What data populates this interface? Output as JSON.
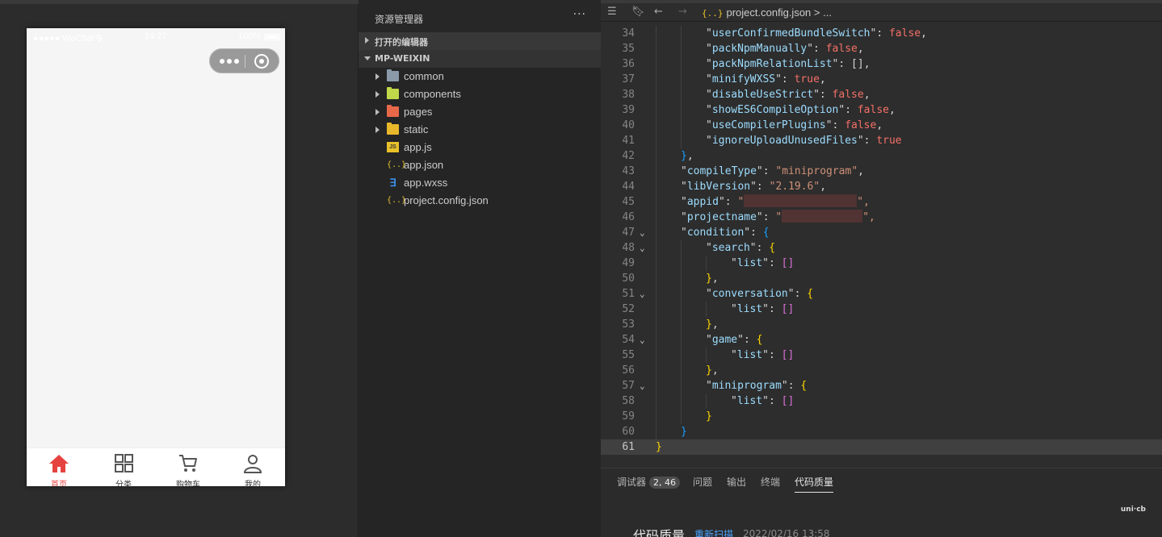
{
  "simulator": {
    "statusbar": {
      "carrier": "●●●●● WeChat令",
      "time": "14:27",
      "battery": "100%"
    },
    "tabbar": [
      {
        "label": "首页",
        "icon": "home-icon",
        "active": true
      },
      {
        "label": "分类",
        "icon": "grid-icon",
        "active": false
      },
      {
        "label": "购物车",
        "icon": "cart-icon",
        "active": false
      },
      {
        "label": "我的",
        "icon": "user-icon",
        "active": false
      }
    ],
    "accent_color": "#e64340"
  },
  "explorer": {
    "title": "资源管理器",
    "more": "···",
    "open_editors": "打开的编辑器",
    "project": "MP-WEIXIN",
    "items": [
      {
        "name": "common",
        "type": "folder",
        "color": "#8a9aa8"
      },
      {
        "name": "components",
        "type": "folder",
        "color": "#c0d74a"
      },
      {
        "name": "pages",
        "type": "folder",
        "color": "#e8684a"
      },
      {
        "name": "static",
        "type": "folder",
        "color": "#e8b82a"
      },
      {
        "name": "app.js",
        "type": "file-js",
        "glyph": "JS"
      },
      {
        "name": "app.json",
        "type": "file-json",
        "glyph": "{..}"
      },
      {
        "name": "app.wxss",
        "type": "file-css",
        "glyph": "∃"
      },
      {
        "name": "project.config.json",
        "type": "file-json",
        "glyph": "{..}"
      }
    ]
  },
  "editor": {
    "breadcrumb": {
      "icon": "{..}",
      "file": "project.config.json",
      "suffix": "> ..."
    },
    "lines": [
      {
        "n": "34",
        "indent": 2,
        "key": "userConfirmedBundleSwitch",
        "val": "false",
        "vtype": "b",
        "end": ","
      },
      {
        "n": "35",
        "indent": 2,
        "key": "packNpmManually",
        "val": "false",
        "vtype": "b",
        "end": ","
      },
      {
        "n": "36",
        "indent": 2,
        "key": "packNpmRelationList",
        "val": "[]",
        "vtype": "p",
        "end": ","
      },
      {
        "n": "37",
        "indent": 2,
        "key": "minifyWXSS",
        "val": "true",
        "vtype": "b",
        "end": ","
      },
      {
        "n": "38",
        "indent": 2,
        "key": "disableUseStrict",
        "val": "false",
        "vtype": "b",
        "end": ","
      },
      {
        "n": "39",
        "indent": 2,
        "key": "showES6CompileOption",
        "val": "false",
        "vtype": "b",
        "end": ","
      },
      {
        "n": "40",
        "indent": 2,
        "key": "useCompilerPlugins",
        "val": "false",
        "vtype": "b",
        "end": ","
      },
      {
        "n": "41",
        "indent": 2,
        "key": "ignoreUploadUnusedFiles",
        "val": "true",
        "vtype": "b",
        "end": ""
      },
      {
        "n": "42",
        "indent": 1,
        "close": "}",
        "cls": "br2",
        "end": ","
      },
      {
        "n": "43",
        "indent": 1,
        "key": "compileType",
        "val": "\"miniprogram\"",
        "vtype": "s",
        "end": ","
      },
      {
        "n": "44",
        "indent": 1,
        "key": "libVersion",
        "val": "\"2.19.6\"",
        "vtype": "s",
        "end": ","
      },
      {
        "n": "45",
        "indent": 1,
        "key": "appid",
        "val": "\"",
        "vtype": "s",
        "redact": 140,
        "end": "\","
      },
      {
        "n": "46",
        "indent": 1,
        "key": "projectname",
        "val": "\"",
        "vtype": "s",
        "redact": 100,
        "end": "\","
      },
      {
        "n": "47",
        "indent": 1,
        "key": "condition",
        "open": "{",
        "cls": "br2",
        "fold": true
      },
      {
        "n": "48",
        "indent": 2,
        "key": "search",
        "open": "{",
        "cls": "br3",
        "fold": true
      },
      {
        "n": "49",
        "indent": 3,
        "key": "list",
        "val": "[]",
        "vtype": "br1",
        "end": ""
      },
      {
        "n": "50",
        "indent": 2,
        "close": "}",
        "cls": "br3",
        "end": ","
      },
      {
        "n": "51",
        "indent": 2,
        "key": "conversation",
        "open": "{",
        "cls": "br3",
        "fold": true
      },
      {
        "n": "52",
        "indent": 3,
        "key": "list",
        "val": "[]",
        "vtype": "br1",
        "end": ""
      },
      {
        "n": "53",
        "indent": 2,
        "close": "}",
        "cls": "br3",
        "end": ","
      },
      {
        "n": "54",
        "indent": 2,
        "key": "game",
        "open": "{",
        "cls": "br3",
        "fold": true
      },
      {
        "n": "55",
        "indent": 3,
        "key": "list",
        "val": "[]",
        "vtype": "br1",
        "end": ""
      },
      {
        "n": "56",
        "indent": 2,
        "close": "}",
        "cls": "br3",
        "end": ","
      },
      {
        "n": "57",
        "indent": 2,
        "key": "miniprogram",
        "open": "{",
        "cls": "br3",
        "fold": true
      },
      {
        "n": "58",
        "indent": 3,
        "key": "list",
        "val": "[]",
        "vtype": "br1",
        "end": ""
      },
      {
        "n": "59",
        "indent": 2,
        "close": "}",
        "cls": "br3",
        "end": ""
      },
      {
        "n": "60",
        "indent": 1,
        "close": "}",
        "cls": "br2",
        "end": ""
      },
      {
        "n": "61",
        "indent": 0,
        "close": "}",
        "cls": "br3",
        "end": "",
        "current": true
      }
    ]
  },
  "panel": {
    "tabs": [
      {
        "label": "调试器",
        "badge": "2, 46"
      },
      {
        "label": "问题"
      },
      {
        "label": "输出"
      },
      {
        "label": "终端"
      },
      {
        "label": "代码质量",
        "active": true
      }
    ],
    "logo": "uni·cb",
    "section_title": "代码质量",
    "rescan": "重新扫描",
    "timestamp": "2022/02/16 13:58"
  }
}
